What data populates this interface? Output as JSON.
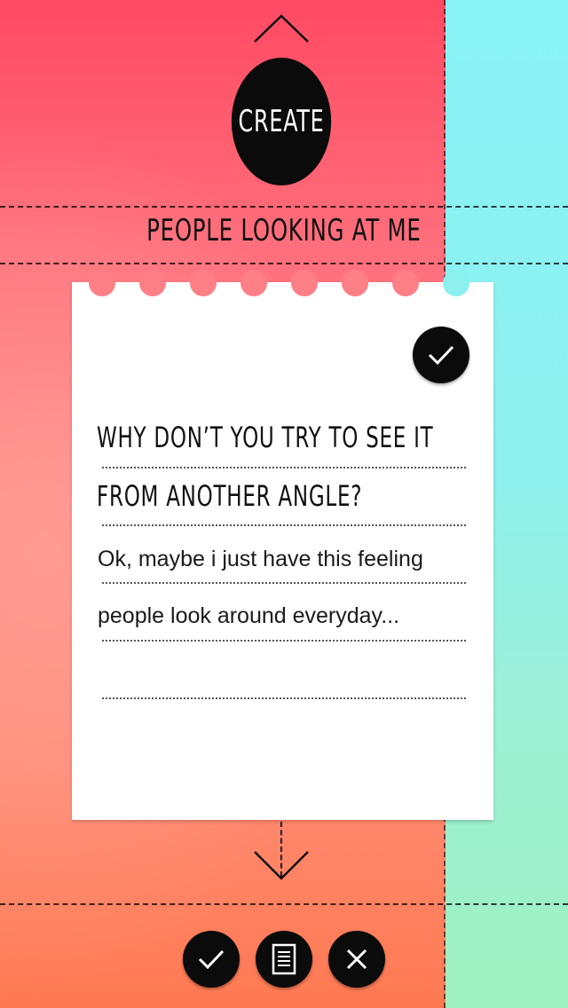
{
  "header": {
    "up_icon": "chevron-up-icon",
    "create_label": "CREATE",
    "category": "PEOPLE LOOKING AT ME"
  },
  "note": {
    "done_icon": "check-icon",
    "question_lines": [
      "WHY DON’T YOU TRY TO SEE IT",
      "FROM ANOTHER ANGLE?"
    ],
    "answer_lines": [
      "Ok, maybe i just have this feeling",
      "people look around everyday...",
      ""
    ]
  },
  "footer": {
    "down_icon": "chevron-down-icon",
    "buttons": [
      {
        "name": "confirm",
        "icon": "check-icon"
      },
      {
        "name": "notes",
        "icon": "document-icon"
      },
      {
        "name": "cancel",
        "icon": "close-icon"
      }
    ]
  },
  "colors": {
    "left_top": "#ff4a63",
    "left_bottom": "#ff7a52",
    "right_top": "#8af3f6",
    "right_bottom": "#9ef0c0",
    "button": "#0b0b0b"
  }
}
